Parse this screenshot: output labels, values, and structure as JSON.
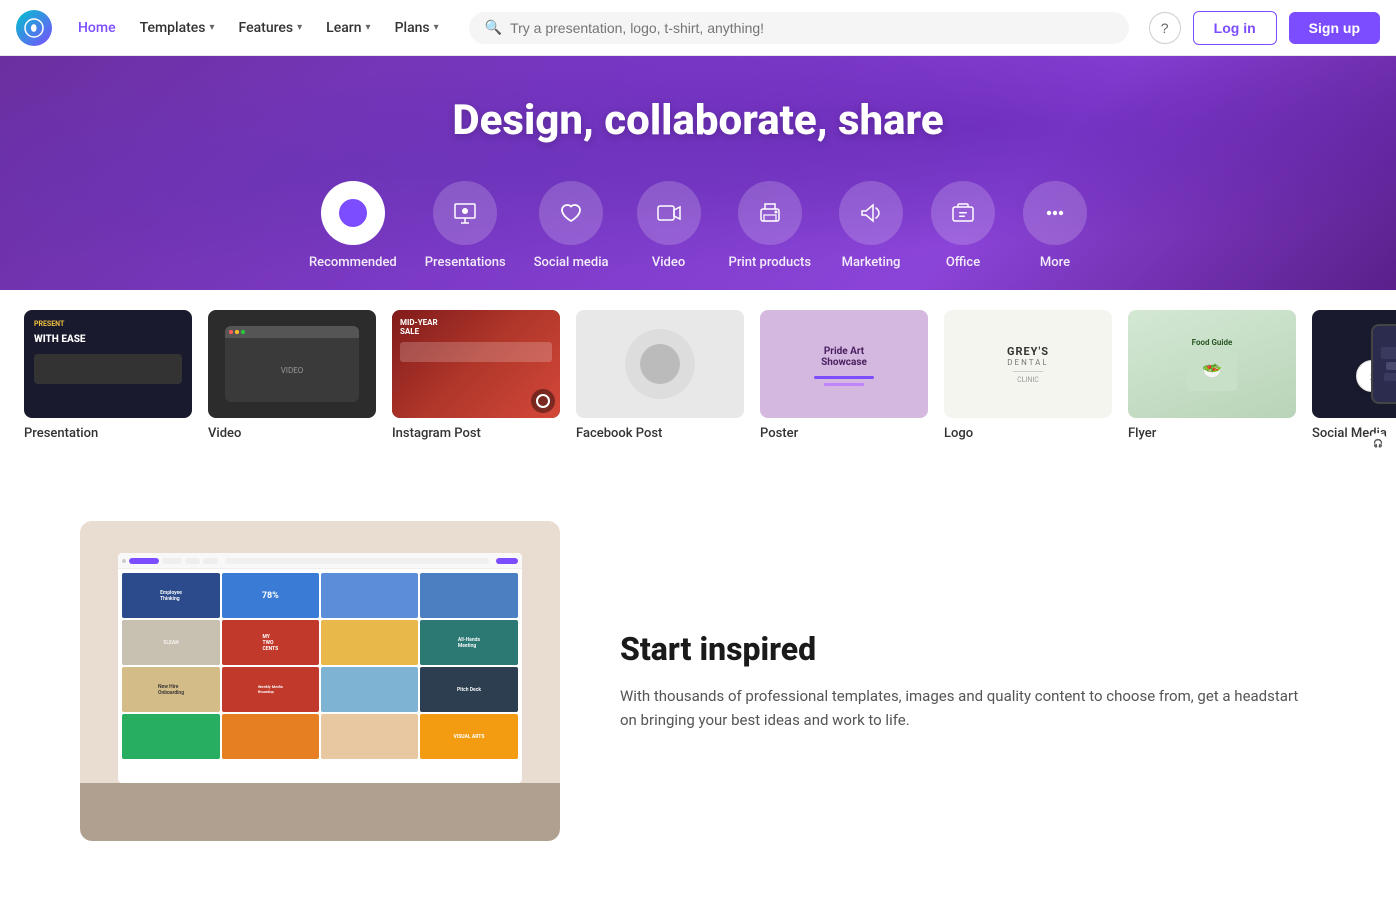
{
  "logo": {
    "text": "Canva"
  },
  "nav": {
    "home": "Home",
    "templates": "Templates",
    "features": "Features",
    "learn": "Learn",
    "plans": "Plans",
    "search_placeholder": "Try a presentation, logo, t-shirt, anything!",
    "help_icon": "?",
    "login": "Log in",
    "signup": "Sign up"
  },
  "hero": {
    "title": "Design, collaborate, share",
    "categories": [
      {
        "id": "recommended",
        "label": "Recommended",
        "icon": "✦",
        "active": true
      },
      {
        "id": "presentations",
        "label": "Presentations",
        "icon": "🖥"
      },
      {
        "id": "social-media",
        "label": "Social media",
        "icon": "♡"
      },
      {
        "id": "video",
        "label": "Video",
        "icon": "▶"
      },
      {
        "id": "print-products",
        "label": "Print products",
        "icon": "🖨"
      },
      {
        "id": "marketing",
        "label": "Marketing",
        "icon": "📣"
      },
      {
        "id": "office",
        "label": "Office",
        "icon": "💼"
      },
      {
        "id": "more",
        "label": "More",
        "icon": "···"
      }
    ]
  },
  "cards": [
    {
      "id": "presentation",
      "label": "Presentation",
      "color": "#1a1a2e"
    },
    {
      "id": "video",
      "label": "Video",
      "color": "#2c2c2c"
    },
    {
      "id": "instagram-post",
      "label": "Instagram Post",
      "color": "#c0392b"
    },
    {
      "id": "facebook-post",
      "label": "Facebook Post",
      "color": "#e0e0e0"
    },
    {
      "id": "poster",
      "label": "Poster",
      "color": "#d4b8e0"
    },
    {
      "id": "logo",
      "label": "Logo",
      "color": "#f5f5f0"
    },
    {
      "id": "flyer",
      "label": "Flyer",
      "color": "#d4e8d4"
    },
    {
      "id": "social-media",
      "label": "Social Media",
      "color": "#1a1a2e"
    }
  ],
  "inspired": {
    "title": "Start inspired",
    "description": "With thousands of professional templates, images and quality content to choose from, get a headstart on bringing your best ideas and work to life."
  },
  "laptop_grid_cells": [
    {
      "bg": "#2b4b8c",
      "text": "Employee\nThinking"
    },
    {
      "bg": "#3a7bd5",
      "text": "78%"
    },
    {
      "bg": "#5b8dd9",
      "text": ""
    },
    {
      "bg": "#4a7fc1",
      "text": ""
    },
    {
      "bg": "#e8e0d0",
      "text": "SLEAN"
    },
    {
      "bg": "#c0392b",
      "text": "MY\nTWO\nCENTS"
    },
    {
      "bg": "#e8b84b",
      "text": ""
    },
    {
      "bg": "#2c7873",
      "text": "All-Hands\nMeeting"
    },
    {
      "bg": "#e8c88a",
      "text": "New Hire\nOnboarding"
    },
    {
      "bg": "#c0392b",
      "text": "Weekly Media\nRoundup"
    },
    {
      "bg": "#7fb3d3",
      "text": ""
    },
    {
      "bg": "#2c3e50",
      "text": "Pitch Deck"
    },
    {
      "bg": "#27ae60",
      "text": ""
    },
    {
      "bg": "#e67e22",
      "text": ""
    },
    {
      "bg": "#e8c8a0",
      "text": ""
    },
    {
      "bg": "#f39c12",
      "text": "VISUAL ARTS"
    }
  ]
}
